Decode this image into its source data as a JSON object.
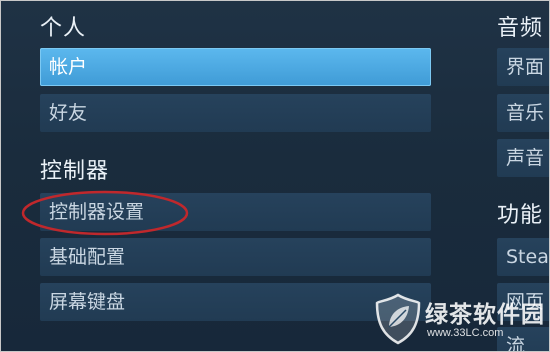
{
  "left": {
    "personal": {
      "heading": "个人",
      "items": [
        {
          "label": "帐户"
        },
        {
          "label": "好友"
        }
      ]
    },
    "controller": {
      "heading": "控制器",
      "items": [
        {
          "label": "控制器设置"
        },
        {
          "label": "基础配置"
        },
        {
          "label": "屏幕键盘"
        }
      ]
    }
  },
  "right": {
    "audio_video": {
      "heading": "音频",
      "items": [
        {
          "label": "界面"
        },
        {
          "label": "音乐"
        },
        {
          "label": "声音"
        }
      ]
    },
    "features": {
      "heading": "功能",
      "items": [
        {
          "label": "Steam"
        },
        {
          "label": "网页"
        },
        {
          "label": "流"
        }
      ]
    }
  },
  "watermark": {
    "title": "绿茶软件园",
    "url": "www.33LC.com"
  },
  "colors": {
    "background": "#1c2f42",
    "selected": "#4aa7e0",
    "item": "#233e57",
    "annotation_circle": "#c0282c"
  }
}
